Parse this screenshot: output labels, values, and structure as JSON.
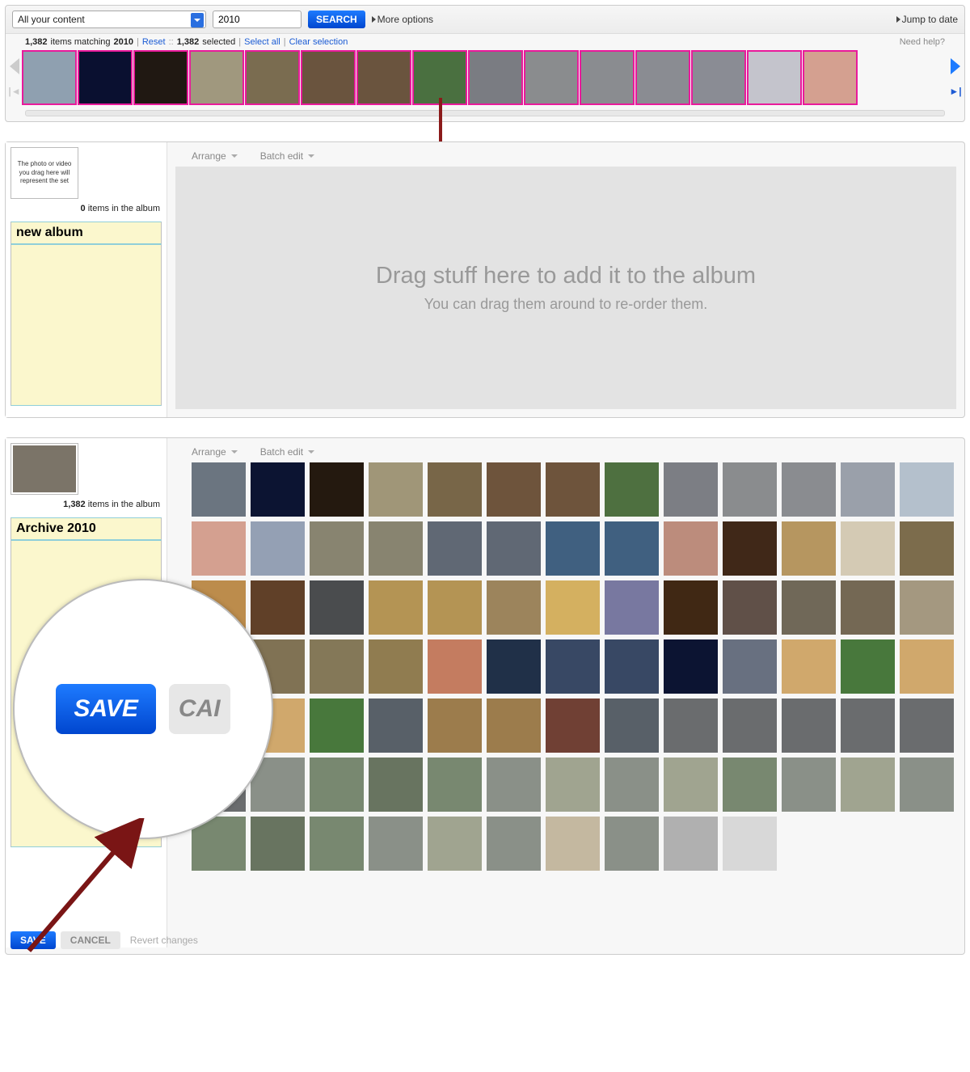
{
  "search": {
    "scope": "All your content",
    "query": "2010",
    "button": "SEARCH",
    "more_options": "More options",
    "jump_to_date": "Jump to date"
  },
  "status": {
    "count_total": "1,382",
    "match_text_1": "items matching",
    "match_text_2": "2010",
    "reset": "Reset",
    "selected_count": "1,382",
    "selected_text": "selected",
    "select_all": "Select all",
    "clear_sel": "Clear selection",
    "need_help": "Need help?"
  },
  "album_empty": {
    "cover_hint": "The photo or video you drag here will represent the set",
    "count_prefix": "0",
    "count_text": "items in the album",
    "title_value": "new album",
    "arrange": "Arrange",
    "batch_edit": "Batch edit",
    "drop_title": "Drag stuff here to add it to the album",
    "drop_sub": "You can drag them around to re-order them."
  },
  "album_full": {
    "count_prefix": "1,382",
    "count_text": "items in the album",
    "title_value": "Archive 2010",
    "arrange": "Arrange",
    "batch_edit": "Batch edit",
    "save": "SAVE",
    "cancel": "CANCEL",
    "revert": "Revert changes"
  },
  "zoom": {
    "save": "SAVE",
    "cancel_partial": "CAI"
  },
  "thumb_colors": [
    "#8fa0b0",
    "#0a1030",
    "#201812",
    "#a0987e",
    "#7a6c50",
    "#6a543e",
    "#6a543e",
    "#4a7040",
    "#7a7c82",
    "#8a8c8e",
    "#8a8c90",
    "#8a8c92",
    "#8a8c94",
    "#c4c4cc",
    "#d4a090"
  ],
  "grid_colors": [
    "#6b7580",
    "#0c1432",
    "#24190f",
    "#a09678",
    "#786648",
    "#6e543c",
    "#6e543c",
    "#4e7040",
    "#7c7e84",
    "#8a8c8e",
    "#8a8c90",
    "#9aa0aa",
    "#b4c0cc",
    "#d4a090",
    "#94a0b4",
    "#888470",
    "#888470",
    "#606874",
    "#606874",
    "#406080",
    "#406080",
    "#bc8c7c",
    "#402818",
    "#b69660",
    "#d4cab4",
    "#7c6c4c",
    "#bc8c4c",
    "#604028",
    "#4a4c4e",
    "#b49454",
    "#b49454",
    "#9c845c",
    "#d4b060",
    "#7878a0",
    "#402814",
    "#605048",
    "#706858",
    "#746854",
    "#a49880",
    "#80704c",
    "#807254",
    "#847858",
    "#907c50",
    "#c47c60",
    "#203048",
    "#384864",
    "#384864",
    "#0c1432",
    "#687080",
    "#d0a86c",
    "#48783c",
    "#d0a86c",
    "#48783c",
    "#d0a86c",
    "#48783c",
    "#586068",
    "#9c7c4c",
    "#9c7c4c",
    "#704034",
    "#586068",
    "#6a6c6e",
    "#6a6c6e",
    "#6a6c6e",
    "#6a6c6e",
    "#6a6c6e",
    "#6a6c6e",
    "#8a9088",
    "#788870",
    "#687460",
    "#788870",
    "#8a9088",
    "#a0a490",
    "#8a9088",
    "#a0a490",
    "#788870",
    "#8a9088",
    "#a0a490",
    "#8a9088",
    "#788870",
    "#687460",
    "#788870",
    "#8a9088",
    "#a0a490",
    "#8a9088",
    "#c4b8a0",
    "#8a9088",
    "#b0b0b0",
    "#d8d8d8"
  ]
}
